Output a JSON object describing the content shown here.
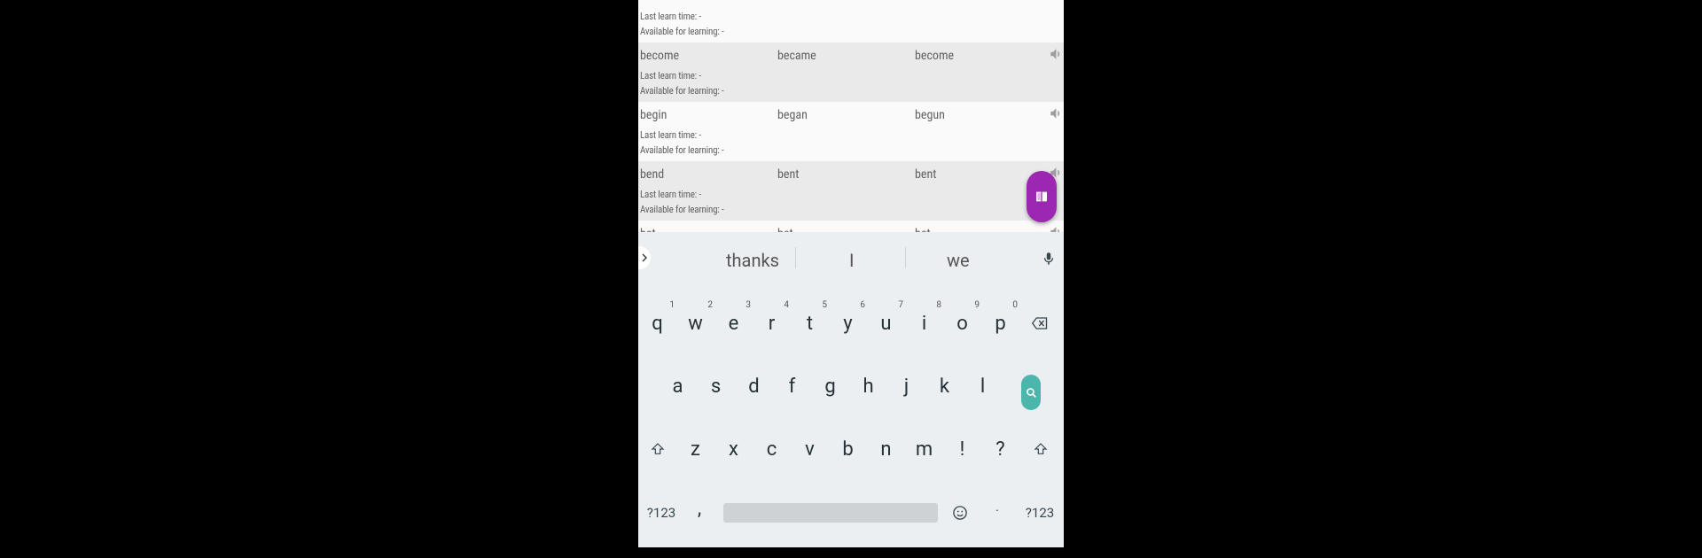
{
  "meta_labels": {
    "last_learn": "Last learn time: -",
    "available": "Available for learning: -"
  },
  "rows": [
    {
      "base": "",
      "past": "",
      "participle": ""
    },
    {
      "base": "become",
      "past": "became",
      "participle": "become"
    },
    {
      "base": "begin",
      "past": "began",
      "participle": "begun"
    },
    {
      "base": "bend",
      "past": "bent",
      "participle": "bent"
    },
    {
      "base": "bet",
      "past": "bet",
      "participle": "bet"
    }
  ],
  "keyboard": {
    "suggestions": [
      "thanks",
      "I",
      "we"
    ],
    "row1": [
      {
        "k": "q",
        "h": "1"
      },
      {
        "k": "w",
        "h": "2"
      },
      {
        "k": "e",
        "h": "3"
      },
      {
        "k": "r",
        "h": "4"
      },
      {
        "k": "t",
        "h": "5"
      },
      {
        "k": "y",
        "h": "6"
      },
      {
        "k": "u",
        "h": "7"
      },
      {
        "k": "i",
        "h": "8"
      },
      {
        "k": "o",
        "h": "9"
      },
      {
        "k": "p",
        "h": "0"
      }
    ],
    "row2": [
      "a",
      "s",
      "d",
      "f",
      "g",
      "h",
      "j",
      "k",
      "l"
    ],
    "row3": [
      "z",
      "x",
      "c",
      "v",
      "b",
      "n",
      "m",
      "!",
      "?"
    ],
    "symbols_label": "?123",
    "comma": ",",
    "period": "·"
  },
  "colors": {
    "fab": "#9c27b0",
    "search": "#4db6ac",
    "keyboard_bg": "#eceff1"
  }
}
